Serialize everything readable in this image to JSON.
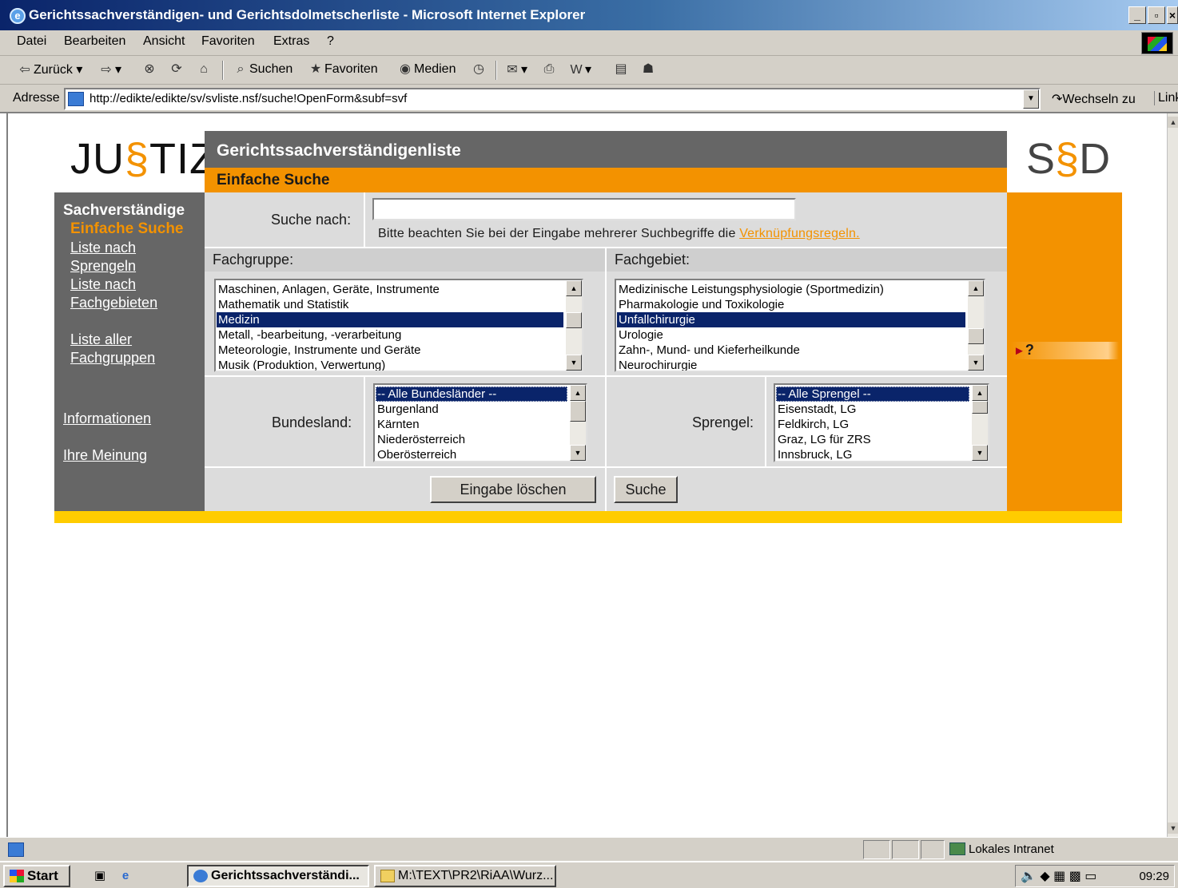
{
  "window": {
    "title": "Gerichtssachverständigen- und Gerichtsdolmetscherliste - Microsoft Internet Explorer",
    "controls": [
      "_",
      "▫",
      "×"
    ]
  },
  "menubar": [
    "Datei",
    "Bearbeiten",
    "Ansicht",
    "Favoriten",
    "Extras",
    "?"
  ],
  "toolbar": {
    "back": "Zurück",
    "search": "Suchen",
    "favorites": "Favoriten",
    "media": "Medien"
  },
  "addressbar": {
    "label": "Adresse",
    "url": "http://edikte/edikte/sv/svliste.nsf/suche!OpenForm&subf=svf",
    "go": "Wechseln zu",
    "links": "Links"
  },
  "page": {
    "logo_left": {
      "pre": "JU",
      "mark": "§",
      "post": "TIZ"
    },
    "logo_right": {
      "pre": "S",
      "mark": "§",
      "post": "D"
    },
    "header_title": "Gerichtssachverständigenliste",
    "header_subtitle": "Einfache Suche",
    "nav": {
      "heading": "Sachverständige",
      "active": "Einfache Suche",
      "links": [
        {
          "line1": "Liste nach",
          "line2": "Sprengeln"
        },
        {
          "line1": "Liste nach",
          "line2": "Fachgebieten"
        },
        {
          "line1": "Liste aller",
          "line2": "Fachgruppen"
        }
      ],
      "info": "Informationen",
      "feedback": "Ihre Meinung"
    },
    "help": "?",
    "search": {
      "label": "Suche nach:",
      "value": "",
      "hint_text": "Bitte beachten Sie bei der Eingabe mehrerer Suchbegriffe die ",
      "hint_link": "Verknüpfungsregeln."
    },
    "fachgruppe": {
      "label": "Fachgruppe:",
      "options": [
        "Maschinen, Anlagen, Geräte, Instrumente",
        "Mathematik und Statistik",
        "Medizin",
        "Metall, -bearbeitung, -verarbeitung",
        "Meteorologie, Instrumente und Geräte",
        "Musik (Produktion, Verwertung)"
      ],
      "selected": "Medizin"
    },
    "fachgebiet": {
      "label": "Fachgebiet:",
      "options": [
        "Medizinische Leistungsphysiologie (Sportmedizin)",
        "Pharmakologie und Toxikologie",
        "Unfallchirurgie",
        "Urologie",
        "Zahn-, Mund- und Kieferheilkunde",
        "Neurochirurgie"
      ],
      "selected": "Unfallchirurgie"
    },
    "bundesland": {
      "label": "Bundesland:",
      "options": [
        "-- Alle Bundesländer --",
        "Burgenland",
        "Kärnten",
        "Niederösterreich",
        "Oberösterreich"
      ],
      "selected": "-- Alle Bundesländer --"
    },
    "sprengel": {
      "label": "Sprengel:",
      "options": [
        "-- Alle Sprengel --",
        "Eisenstadt, LG",
        "Feldkirch, LG",
        "Graz, LG für ZRS",
        "Innsbruck, LG"
      ],
      "selected": "-- Alle Sprengel --"
    },
    "buttons": {
      "clear": "Eingabe löschen",
      "search": "Suche"
    }
  },
  "statusbar": {
    "zone": "Lokales Intranet"
  },
  "taskbar": {
    "start": "Start",
    "tasks": [
      {
        "label": "Gerichtssachverständi...",
        "active": true
      },
      {
        "label": "M:\\TEXT\\PR2\\RiAA\\Wurz...",
        "active": false
      }
    ],
    "clock": "09:29"
  },
  "colors": {
    "accent_orange": "#f39200",
    "header_gray": "#666666",
    "footer_yellow": "#ffcc00",
    "selection_blue": "#0a246a"
  }
}
